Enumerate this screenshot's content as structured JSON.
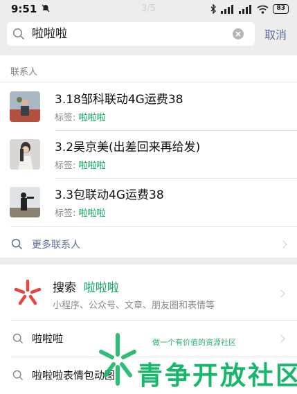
{
  "status_bar": {
    "time": "9:51",
    "page_indicator": "3/5",
    "battery": "83"
  },
  "search": {
    "query": "啦啦啦",
    "cancel_label": "取消"
  },
  "contacts": {
    "section_label": "联系人",
    "tag_prefix": "标签: ",
    "items": [
      {
        "name": "3.18邹科联动4G运费38",
        "tag": "啦啦啦"
      },
      {
        "name": "3.2吴京美(出差回来再给发)",
        "tag": "啦啦啦"
      },
      {
        "name": "3.3包联动4G运费38",
        "tag": "啦啦啦"
      }
    ],
    "more_label": "更多联系人"
  },
  "wechat_search": {
    "title": "搜索",
    "keyword": "啦啦啦",
    "subtitle": "小程序、公众号、文章、朋友圈和表情等",
    "brand_color": "#e6453f"
  },
  "suggestions": [
    {
      "text": "啦啦啦"
    },
    {
      "text": "啦啦啦表情包动图"
    }
  ],
  "watermark": {
    "caption": "做一个有价值的资源社区",
    "brand": "青争开放社区"
  },
  "colors": {
    "accent_link": "#576b95",
    "tag_green": "#07a45d",
    "watermark_green": "#17b86a"
  }
}
